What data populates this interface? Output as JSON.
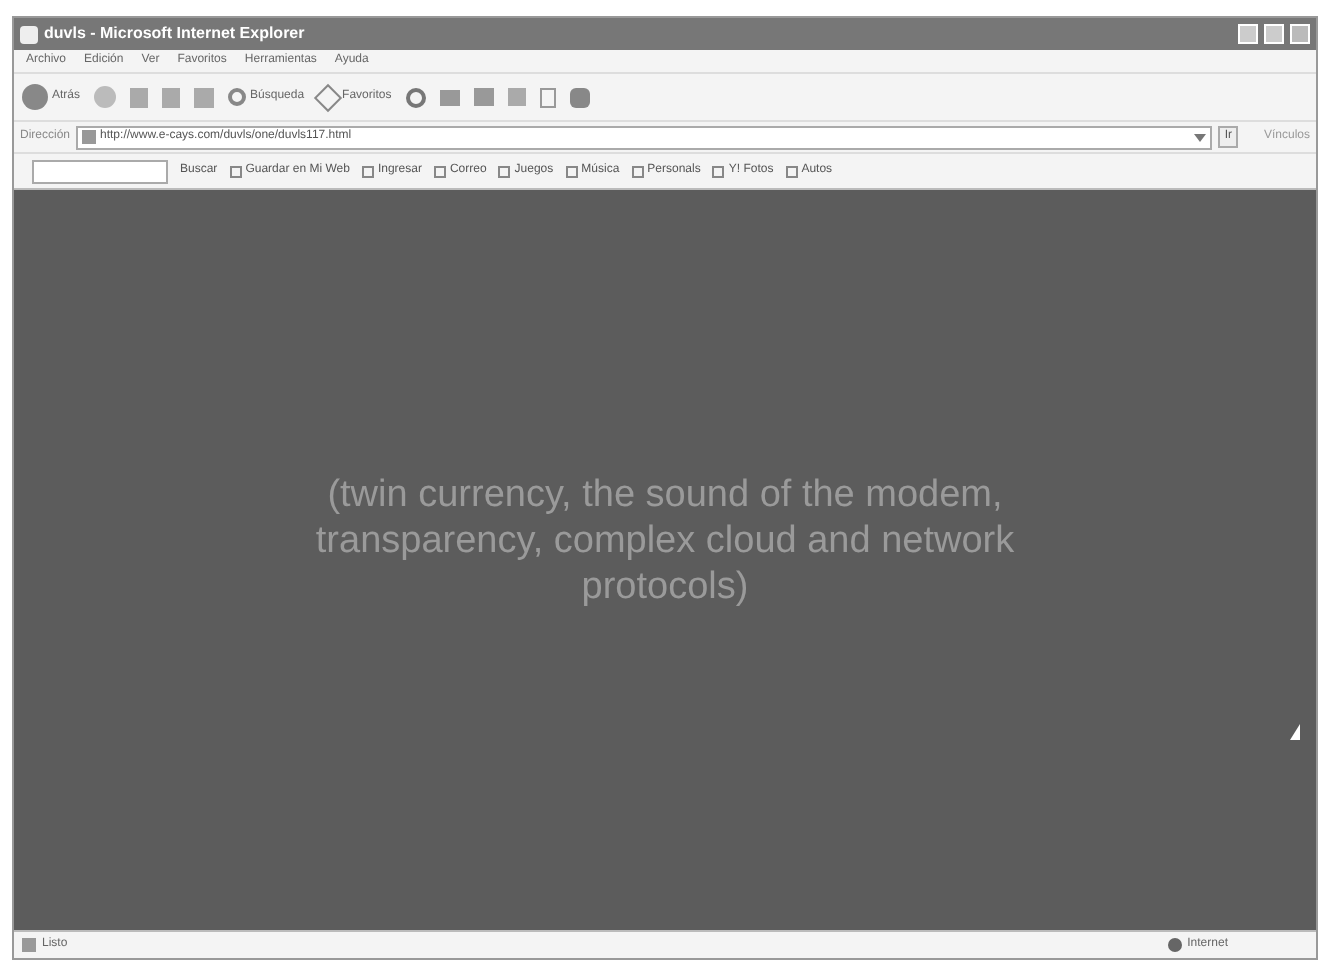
{
  "window": {
    "title": "duvls - Microsoft Internet Explorer"
  },
  "menu": [
    "Archivo",
    "Edición",
    "Ver",
    "Favoritos",
    "Herramientas",
    "Ayuda"
  ],
  "toolbar": [
    {
      "kind": "back",
      "label": "Atrás"
    },
    {
      "kind": "forward"
    },
    {
      "kind": "stop"
    },
    {
      "kind": "refresh"
    },
    {
      "kind": "home"
    },
    {
      "kind": "search",
      "label": "Búsqueda"
    },
    {
      "kind": "favorites",
      "label": "Favoritos"
    },
    {
      "kind": "history"
    },
    {
      "kind": "mail"
    },
    {
      "kind": "print"
    },
    {
      "kind": "edit"
    },
    {
      "kind": "page"
    },
    {
      "kind": "messenger"
    }
  ],
  "address": {
    "label": "Dirección",
    "value": "http://www.e-cays.com/duvls/one/duvls117.html",
    "go": "Ir",
    "links": "Vínculos"
  },
  "yahoo_toolbar": {
    "search_button": "Buscar",
    "items": [
      "Guardar en Mi Web",
      "Ingresar",
      "Correo",
      "Juegos",
      "Música",
      "Personals",
      "Y! Fotos",
      "Autos"
    ]
  },
  "content": {
    "text": "(twin currency, the sound of the modem, transparency, complex cloud and network protocols)"
  },
  "status_bar": {
    "status": "Listo",
    "zone": "Internet"
  }
}
